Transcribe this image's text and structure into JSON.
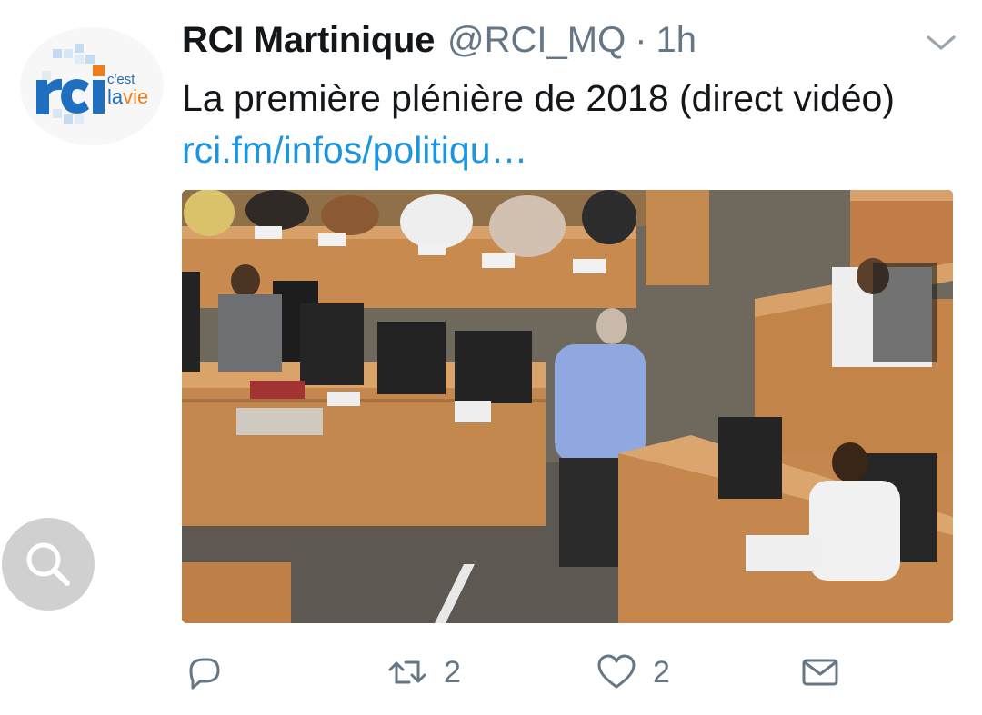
{
  "tweet": {
    "author_name": "RCI Martinique",
    "handle": "@RCI_MQ",
    "separator": "·",
    "time": "1h",
    "text_prefix": "La première plénière de 2018 (direct vidéo) ",
    "link_text": "rci.fm/infos/politiqu…",
    "avatar": {
      "logo_text": "rci",
      "tagline_top": "c'est",
      "tagline_bottom": "la vie"
    },
    "media": {
      "type": "photo",
      "subject": "assembly-plenary-session"
    }
  },
  "actions": {
    "reply": {
      "icon": "reply-icon",
      "count": ""
    },
    "retweet": {
      "icon": "retweet-icon",
      "count": "2"
    },
    "like": {
      "icon": "heart-icon",
      "count": "2"
    },
    "message": {
      "icon": "envelope-icon",
      "count": ""
    }
  },
  "colors": {
    "link": "#1b95e0",
    "secondary_text": "#657786",
    "primary_text": "#14171a",
    "brand_blue": "#1f6fc0",
    "brand_orange": "#ef7d1a"
  }
}
